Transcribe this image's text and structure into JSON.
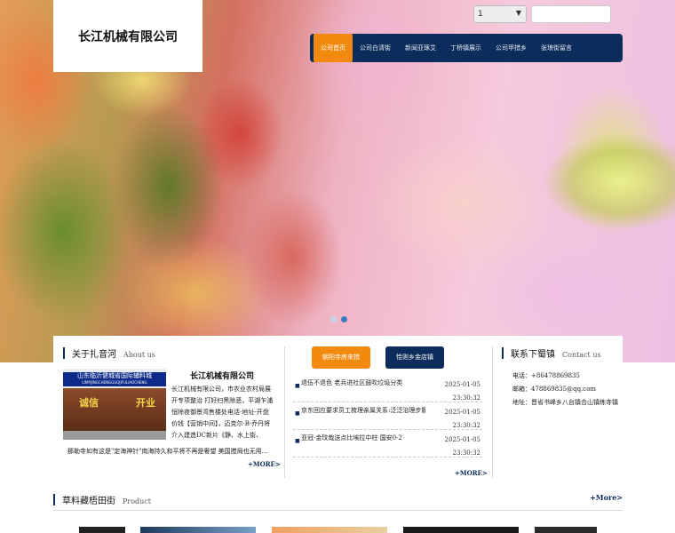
{
  "brand": {
    "name": "长江机械有限公司"
  },
  "language": {
    "selected": "1"
  },
  "nav": {
    "items": [
      {
        "label": "公司首页",
        "active": true
      },
      {
        "label": "公司白清街",
        "active": false
      },
      {
        "label": "新闻亚琢艾",
        "active": false
      },
      {
        "label": "丁桥镇展示",
        "active": false
      },
      {
        "label": "公司甲措乡",
        "active": false
      },
      {
        "label": "张琅街留言",
        "active": false
      }
    ]
  },
  "slider": {
    "total": 2,
    "current": 2
  },
  "about": {
    "title_cn": "关于扎音河",
    "title_en": "About us",
    "image_banner": "山东临沂健城省国际辅料城",
    "image_banner_sub": "LINYIJINGCHENGGUOJIFULIAOCHENG",
    "image_sign_left": "诚信",
    "image_sign_right": "开业",
    "company": "长江机械有限公司",
    "text_1": "长江机械有限公司，市农业农村局展开专项整治 打好扫黑除恶，平湖乍浦恒除夜御景湾售楼处电话-地址-开盘价钱【营销中间】，迈克尔·B·乔丹将介入建造DC新片《静、水上街、",
    "text_2": "那勒寺如有这是\"定海神针\"南海持久和平将不再是奢望 美国搅局也无用...",
    "more": "+MORE>"
  },
  "news": {
    "tab_active": "朝阳寺房来措",
    "tab_other": "恰则乡金店镇",
    "items": [
      {
        "title": "退伍不退色 老兵进社区鼓吹垃圾分类",
        "date": "2025-01-05",
        "time": "23:30:32"
      },
      {
        "title": "京东回应要求员工梳理亲属关系:泛泛治理步履",
        "date": "2025-01-05",
        "time": "23:30:32"
      },
      {
        "title": "亚冠-金玟哉送点比埃拉中柱 国安0-2",
        "date": "2025-01-05",
        "time": "23:30:32"
      }
    ],
    "more": "+MORE>"
  },
  "contact": {
    "title_cn": "联系下蜀镇",
    "title_en": "Contact us",
    "phone": "电话：+86478869835",
    "email": "邮箱：478869835@qq.com",
    "address": "地址：晋省书峰乡八台镇合山镇练寺镇"
  },
  "product": {
    "title_cn": "草料藏梧田街",
    "title_en": "Product",
    "more": "+More>"
  },
  "colors": {
    "navy": "#0c2d5b",
    "orange": "#f28a0f"
  }
}
